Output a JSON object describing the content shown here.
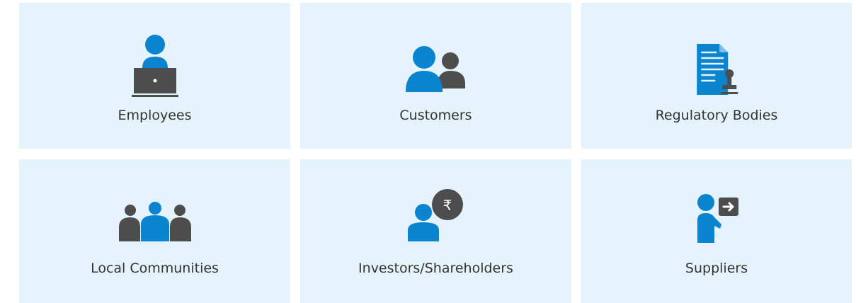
{
  "colors": {
    "card_bg": "#e5f3fc",
    "accent": "#0a84cf",
    "dark": "#4d4d4d",
    "text": "#333333"
  },
  "cards": [
    {
      "label": "Employees",
      "icon": "employee-laptop-icon"
    },
    {
      "label": "Customers",
      "icon": "customers-icon"
    },
    {
      "label": "Regulatory Bodies",
      "icon": "document-stamp-icon"
    },
    {
      "label": "Local Communities",
      "icon": "community-icon"
    },
    {
      "label": "Investors/Shareholders",
      "icon": "investor-rupee-icon"
    },
    {
      "label": "Suppliers",
      "icon": "supplier-arrow-icon"
    }
  ]
}
